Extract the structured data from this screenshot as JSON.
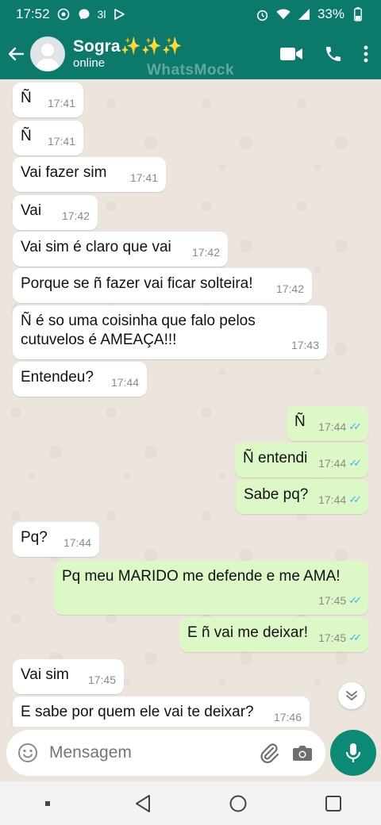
{
  "status_bar": {
    "time": "17:52",
    "signal_text": "3l",
    "battery": "33%",
    "icons": [
      "whatsapp-icon",
      "messenger-icon",
      "signal-icon",
      "play-icon",
      "alarm-icon",
      "wifi-icon",
      "cell-signal-icon",
      "battery-icon"
    ]
  },
  "header": {
    "contact_name": "Sogra✨✨✨",
    "contact_status": "online",
    "watermark": "WhatsMock",
    "icons": [
      "back-arrow-icon",
      "avatar",
      "video-call-icon",
      "phone-icon",
      "more-vert-icon"
    ]
  },
  "messages": [
    {
      "dir": "in",
      "text": "Ñ",
      "time": "17:41"
    },
    {
      "dir": "in",
      "text": "Ñ",
      "time": "17:41"
    },
    {
      "dir": "in",
      "text": "Vai fazer sim",
      "time": "17:41"
    },
    {
      "dir": "in",
      "text": "Vai",
      "time": "17:42"
    },
    {
      "dir": "in",
      "text": "Vai sim é claro que vai",
      "time": "17:42"
    },
    {
      "dir": "in",
      "text": "Porque se ñ fazer vai ficar solteira!",
      "time": "17:42"
    },
    {
      "dir": "in",
      "text": "Ñ é so uma coisinha que falo pelos\ncutuvelos é AMEAÇA!!!",
      "time": "17:43"
    },
    {
      "dir": "in",
      "text": "Entendeu?",
      "time": "17:44"
    },
    {
      "dir": "out",
      "text": "Ñ",
      "time": "17:44",
      "read": "✓✓"
    },
    {
      "dir": "out",
      "text": "Ñ entendi",
      "time": "17:44",
      "read": "✓✓"
    },
    {
      "dir": "out",
      "text": "Sabe pq?",
      "time": "17:44",
      "read": "✓✓"
    },
    {
      "dir": "in",
      "text": "Pq?",
      "time": "17:44"
    },
    {
      "dir": "out",
      "text": "Pq meu MARIDO me defende e me AMA!",
      "time": "17:45",
      "read": "✓✓"
    },
    {
      "dir": "out",
      "text": "E ñ vai me deixar!",
      "time": "17:45",
      "read": "✓✓"
    },
    {
      "dir": "in",
      "text": "Vai sim",
      "time": "17:45"
    },
    {
      "dir": "in",
      "text": "E sabe por quem ele vai te deixar?",
      "time": "17:46"
    }
  ],
  "input": {
    "placeholder": "Mensagem"
  },
  "colors": {
    "header": "#0b7a6b",
    "incoming_bubble": "#ffffff",
    "outgoing_bubble": "#dcf8c6",
    "read_ticks": "#34b7f1",
    "mic_button": "#0b8a76"
  }
}
